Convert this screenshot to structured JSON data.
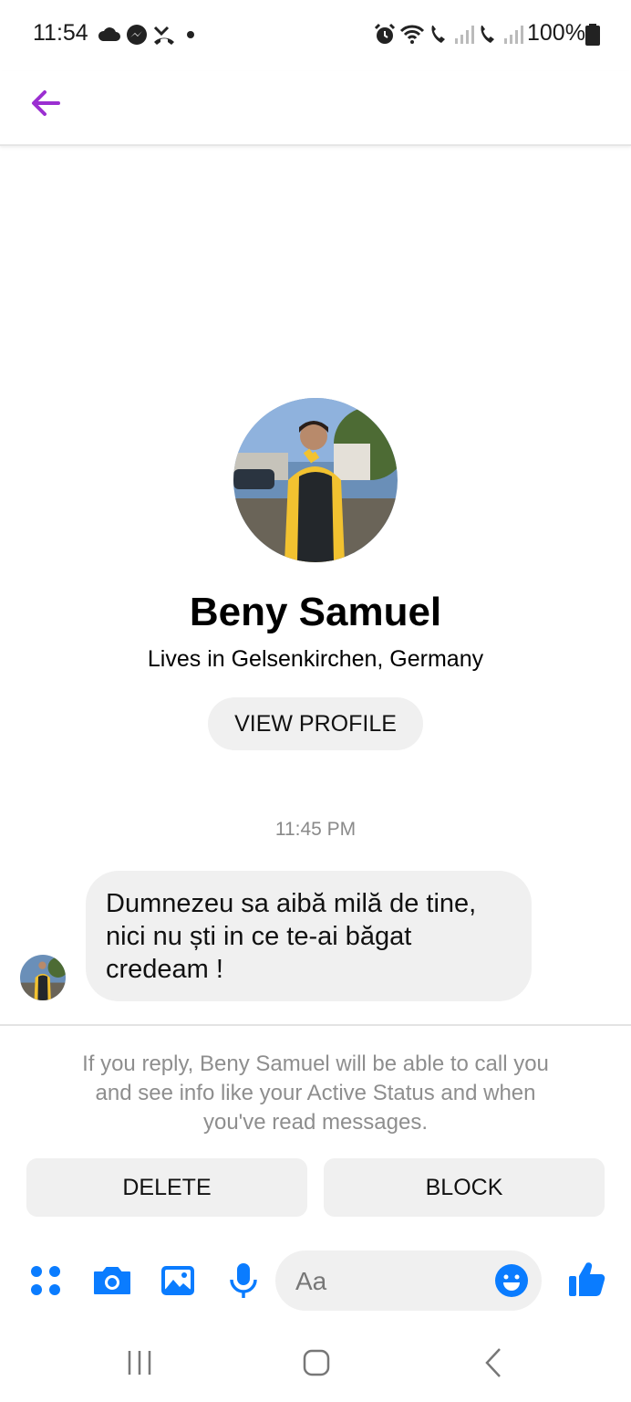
{
  "status_bar": {
    "time": "11:54",
    "left_icons": [
      "cloud-icon",
      "messenger-icon",
      "missed-call-icon",
      "dot-icon"
    ],
    "right_icons": [
      "alarm-icon",
      "wifi-icon",
      "call-sim1-icon",
      "signal-icon",
      "call-sim2-icon",
      "signal-icon",
      "battery-icon"
    ],
    "battery": "100%"
  },
  "header": {
    "back_icon": "arrow-left-icon",
    "accent_color": "#9b2fd1"
  },
  "profile": {
    "name": "Beny Samuel",
    "location": "Lives in Gelsenkirchen, Germany",
    "view_profile_label": "VIEW PROFILE"
  },
  "conversation": {
    "timestamp": "11:45 PM",
    "message_lines": [
      "Dumnezeu sa aibă milă de tine,",
      "nici nu ști in ce te-ai băgat",
      "credeam !"
    ]
  },
  "request": {
    "notice_lines": [
      "If you reply, Beny Samuel will be able to call you",
      "and see info like your Active Status and when",
      "you've read messages."
    ],
    "delete_label": "DELETE",
    "block_label": "BLOCK"
  },
  "composer": {
    "placeholder": "Aa",
    "icon_color": "#0a7cff",
    "icons": [
      "apps-icon",
      "camera-icon",
      "gallery-icon",
      "microphone-icon",
      "emoji-icon",
      "thumbs-up-icon"
    ]
  },
  "nav_bar": {
    "buttons": [
      "recents-icon",
      "home-icon",
      "back-icon"
    ]
  }
}
